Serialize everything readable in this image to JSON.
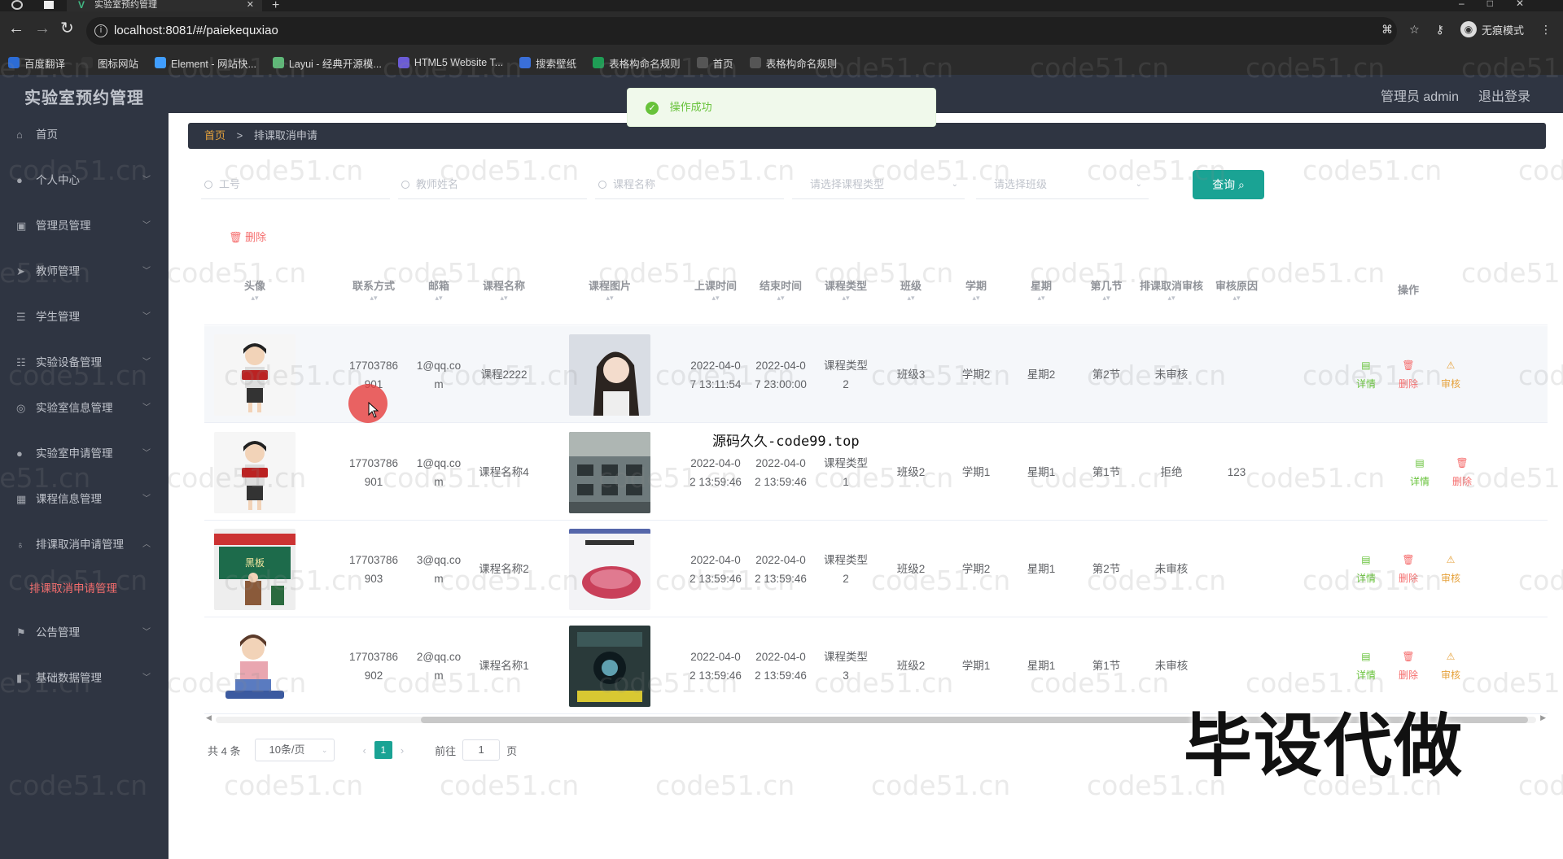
{
  "browser": {
    "tab_title": "实验室预约管理",
    "url": "localhost:8081/#/paiekequxiao",
    "incognito_label": "无痕模式",
    "bookmarks": [
      {
        "label": "百度翻译",
        "color": "#2c6cd6"
      },
      {
        "label": "图标网站",
        "color": "#333333"
      },
      {
        "label": "Element - 网站快...",
        "color": "#409eff"
      },
      {
        "label": "Layui - 经典开源模...",
        "color": "#5fb878"
      },
      {
        "label": "HTML5 Website T...",
        "color": "#6b5bd6"
      },
      {
        "label": "搜索壁纸",
        "color": "#3a6fd8"
      },
      {
        "label": "表格构命名规则",
        "color": "#1f9d55"
      },
      {
        "label": "首页",
        "color": "#555555"
      },
      {
        "label": "表格构命名规则",
        "color": "#555555"
      }
    ]
  },
  "app": {
    "title": "实验室预约管理",
    "user_label": "管理员 admin",
    "logout_label": "退出登录"
  },
  "sidebar": {
    "items": [
      {
        "label": "首页",
        "icon": "home-icon",
        "has_arrow": false
      },
      {
        "label": "个人中心",
        "icon": "user-icon",
        "has_arrow": true
      },
      {
        "label": "管理员管理",
        "icon": "admin-icon",
        "has_arrow": true
      },
      {
        "label": "教师管理",
        "icon": "send-icon",
        "has_arrow": true
      },
      {
        "label": "学生管理",
        "icon": "list-icon",
        "has_arrow": true
      },
      {
        "label": "实验设备管理",
        "icon": "equipment-icon",
        "has_arrow": true
      },
      {
        "label": "实验室信息管理",
        "icon": "info-icon",
        "has_arrow": true
      },
      {
        "label": "实验室申请管理",
        "icon": "person-icon",
        "has_arrow": true
      },
      {
        "label": "课程信息管理",
        "icon": "grid-icon",
        "has_arrow": true
      },
      {
        "label": "排课取消申请管理",
        "icon": "mic-icon",
        "has_arrow": true,
        "expanded": true
      },
      {
        "label": "公告管理",
        "icon": "flag-icon",
        "has_arrow": true
      },
      {
        "label": "基础数据管理",
        "icon": "bar-chart-icon",
        "has_arrow": true
      }
    ],
    "active_sub": "排课取消申请管理"
  },
  "breadcrumb": {
    "home": "首页",
    "separator": ">",
    "current": "排课取消申请"
  },
  "toast": {
    "message": "操作成功"
  },
  "search": {
    "job_no_placeholder": "工号",
    "teacher_name_placeholder": "教师姓名",
    "course_name_placeholder": "课程名称",
    "course_type_placeholder": "请选择课程类型",
    "class_placeholder": "请选择班级",
    "query_label": "查询"
  },
  "actions": {
    "delete_label": "删除"
  },
  "table": {
    "columns": [
      "头像",
      "联系方式",
      "邮箱",
      "课程名称",
      "课程图片",
      "上课时间",
      "结束时间",
      "课程类型",
      "班级",
      "学期",
      "星期",
      "第几节",
      "排课取消审核",
      "审核原因",
      "操作"
    ],
    "op_labels": {
      "detail": "详情",
      "delete": "删除",
      "audit": "审核"
    },
    "rows": [
      {
        "phone": "17703786901",
        "email": "1@qq.com",
        "course": "课程2222",
        "start": "2022-04-07 13:11:54",
        "end": "2022-04-07 23:00:00",
        "type": "课程类型2",
        "class": "班级3",
        "term": "学期2",
        "weekday": "星期2",
        "section": "第2节",
        "status": "未审核",
        "reason": "",
        "avatar": "girl-reading",
        "pic": "woman-portrait",
        "audit": true
      },
      {
        "phone": "17703786901",
        "email": "1@qq.com",
        "course": "课程名称4",
        "start": "2022-04-02 13:59:46",
        "end": "2022-04-02 13:59:46",
        "type": "课程类型1",
        "class": "班级2",
        "term": "学期1",
        "weekday": "星期1",
        "section": "第1节",
        "status": "拒绝",
        "reason": "123",
        "avatar": "girl-reading",
        "pic": "classroom",
        "audit": false
      },
      {
        "phone": "17703786903",
        "email": "3@qq.com",
        "course": "课程名称2",
        "start": "2022-04-02 13:59:46",
        "end": "2022-04-02 13:59:46",
        "type": "课程类型2",
        "class": "班级2",
        "term": "学期2",
        "weekday": "星期1",
        "section": "第2节",
        "status": "未审核",
        "reason": "",
        "avatar": "blackboard",
        "pic": "book-cover",
        "audit": true
      },
      {
        "phone": "17703786902",
        "email": "2@qq.com",
        "course": "课程名称1",
        "start": "2022-04-02 13:59:46",
        "end": "2022-04-02 13:59:46",
        "type": "课程类型3",
        "class": "班级2",
        "term": "学期1",
        "weekday": "星期1",
        "section": "第1节",
        "status": "未审核",
        "reason": "",
        "avatar": "girl-laptop",
        "pic": "dark-book",
        "audit": true
      }
    ]
  },
  "pagination": {
    "total": "共 4 条",
    "page_size": "10条/页",
    "current": "1",
    "goto": "前往",
    "page_suffix": "页",
    "goto_value": "1"
  },
  "overlays": {
    "watermark": "code51.cn",
    "big_text": "毕设代做",
    "mid_text": "源码久久-code99.top"
  },
  "colors": {
    "primary": "#1aa394",
    "sidebar": "#2f3542",
    "danger": "#f56c6c",
    "success": "#67c23a",
    "warning": "#e6a23c"
  }
}
